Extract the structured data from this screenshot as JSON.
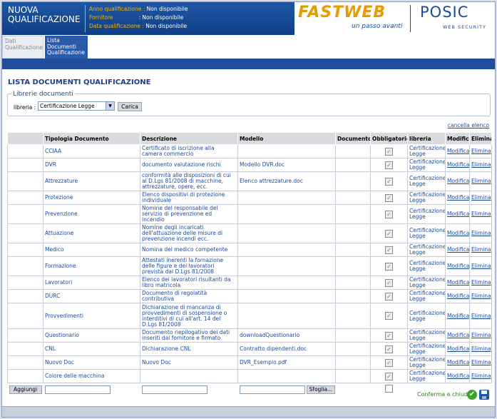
{
  "header": {
    "title_line1": "NUOVA",
    "title_line2": "QUALIFICAZIONE",
    "meta": [
      {
        "key": "Anno qualificazione :",
        "value": "Non disponibile"
      },
      {
        "key": "Fornitore",
        "value": ": Non disponibile"
      },
      {
        "key": "Data qualificazione :",
        "value": "Non disponibile"
      }
    ],
    "brand_logo": "FASTWEB",
    "brand_tagline": "un passo avanti",
    "product_logo": "POSIC",
    "product_tagline": "WEB SECURITY"
  },
  "tabs": [
    {
      "label": "Dati Qualificazione",
      "active": false
    },
    {
      "label": "Lista Documenti Qualificazione",
      "active": true
    }
  ],
  "page_title": "LISTA DOCUMENTI QUALIFICAZIONE",
  "librerie": {
    "legend": "Librerie documenti",
    "label": "libreria :",
    "selected": "Certificazione Legge",
    "load_button": "Carica"
  },
  "cancella_elenco": "cancella elenco",
  "table": {
    "headers": [
      "",
      "Tipologia Documento",
      "Descrizione",
      "Modello",
      "Documento",
      "Obbligatorio",
      "libreria",
      "Modifica",
      "Elimina"
    ],
    "rows": [
      {
        "tipologia": "CCIAA",
        "descrizione": "Certificato di iscrizione alla camera commercio",
        "modello": "",
        "libreria": "Certificazione Legge",
        "checked": true
      },
      {
        "tipologia": "DVR",
        "descrizione": "documento valutazione rischi",
        "modello": "Modello DVR.doc",
        "libreria": "Certificazione Legge",
        "checked": true
      },
      {
        "tipologia": "Attrezzature",
        "descrizione": "conformità alle disposizioni di cui al D.Lgs 81/2008 di macchine, attrezzature, opere, ecc.",
        "modello": "Elenco attrezzature.doc",
        "libreria": "Certificazione Legge",
        "checked": true
      },
      {
        "tipologia": "Protezione",
        "descrizione": "Elenco dispositivi di protezione individuale",
        "modello": "",
        "libreria": "Certificazione Legge",
        "checked": true
      },
      {
        "tipologia": "Prevenzione",
        "descrizione": "Nomine del responsabile del servizio di prevenzione ed incendio",
        "modello": "",
        "libreria": "Certificazione Legge",
        "checked": true
      },
      {
        "tipologia": "Attuazione",
        "descrizione": "Nomine degli incaricati dell'attuazione delle misure di prevenzione incendi ecc.",
        "modello": "",
        "libreria": "Certificazione Legge",
        "checked": true
      },
      {
        "tipologia": "Medico",
        "descrizione": "Nomina del medico competente",
        "modello": "",
        "libreria": "Certificazione Legge",
        "checked": true
      },
      {
        "tipologia": "Formazione",
        "descrizione": "Attestati inerenti la fornazione delle figure e dei lavoratori prevista dal D.Lgs 81/2008",
        "modello": "",
        "libreria": "Certificazione Legge",
        "checked": true
      },
      {
        "tipologia": "Lavoratori",
        "descrizione": "Elenco dei lavoratori risultanti da libro matricola",
        "modello": "",
        "libreria": "Certificazione Legge",
        "checked": true
      },
      {
        "tipologia": "DURC",
        "descrizione": "Documento di regolatità contributiva",
        "modello": "",
        "libreria": "Certificazione Legge",
        "checked": true
      },
      {
        "tipologia": "Provvedimenti",
        "descrizione": "Dichiarazione di mancanza di provvedimenti di sospensione o interditivi di cui all'art. 14 del D.Lgs 81/2008",
        "modello": "",
        "libreria": "Certificazione Legge",
        "checked": true
      },
      {
        "tipologia": "Questionario",
        "descrizione": "Documento riepilogativo dei dati inseriti dal fornitore e firmato",
        "modello": "downloadQuestionario",
        "libreria": "Certificazione Legge",
        "checked": true
      },
      {
        "tipologia": "CNL",
        "descrizione": "Dichiarazione CNL",
        "modello": "Contratto dipendenti.doc",
        "libreria": "Certificazione Legge",
        "checked": true
      },
      {
        "tipologia": "Nuovo Doc",
        "descrizione": "Nuovo Doc",
        "modello": "DVR_Esempio.pdf",
        "libreria": "Certificazione Legge",
        "checked": true
      },
      {
        "tipologia": "Colore delle macchina",
        "descrizione": "",
        "modello": "",
        "libreria": "Certificazione Legge",
        "checked": true
      }
    ],
    "modifica_label": "Modifica",
    "elimina_label": "Elimina",
    "add_button": "Aggiungi",
    "browse_button": "Sfoglia..."
  },
  "footer": {
    "confirm_label": "Conferma e chiudi"
  }
}
